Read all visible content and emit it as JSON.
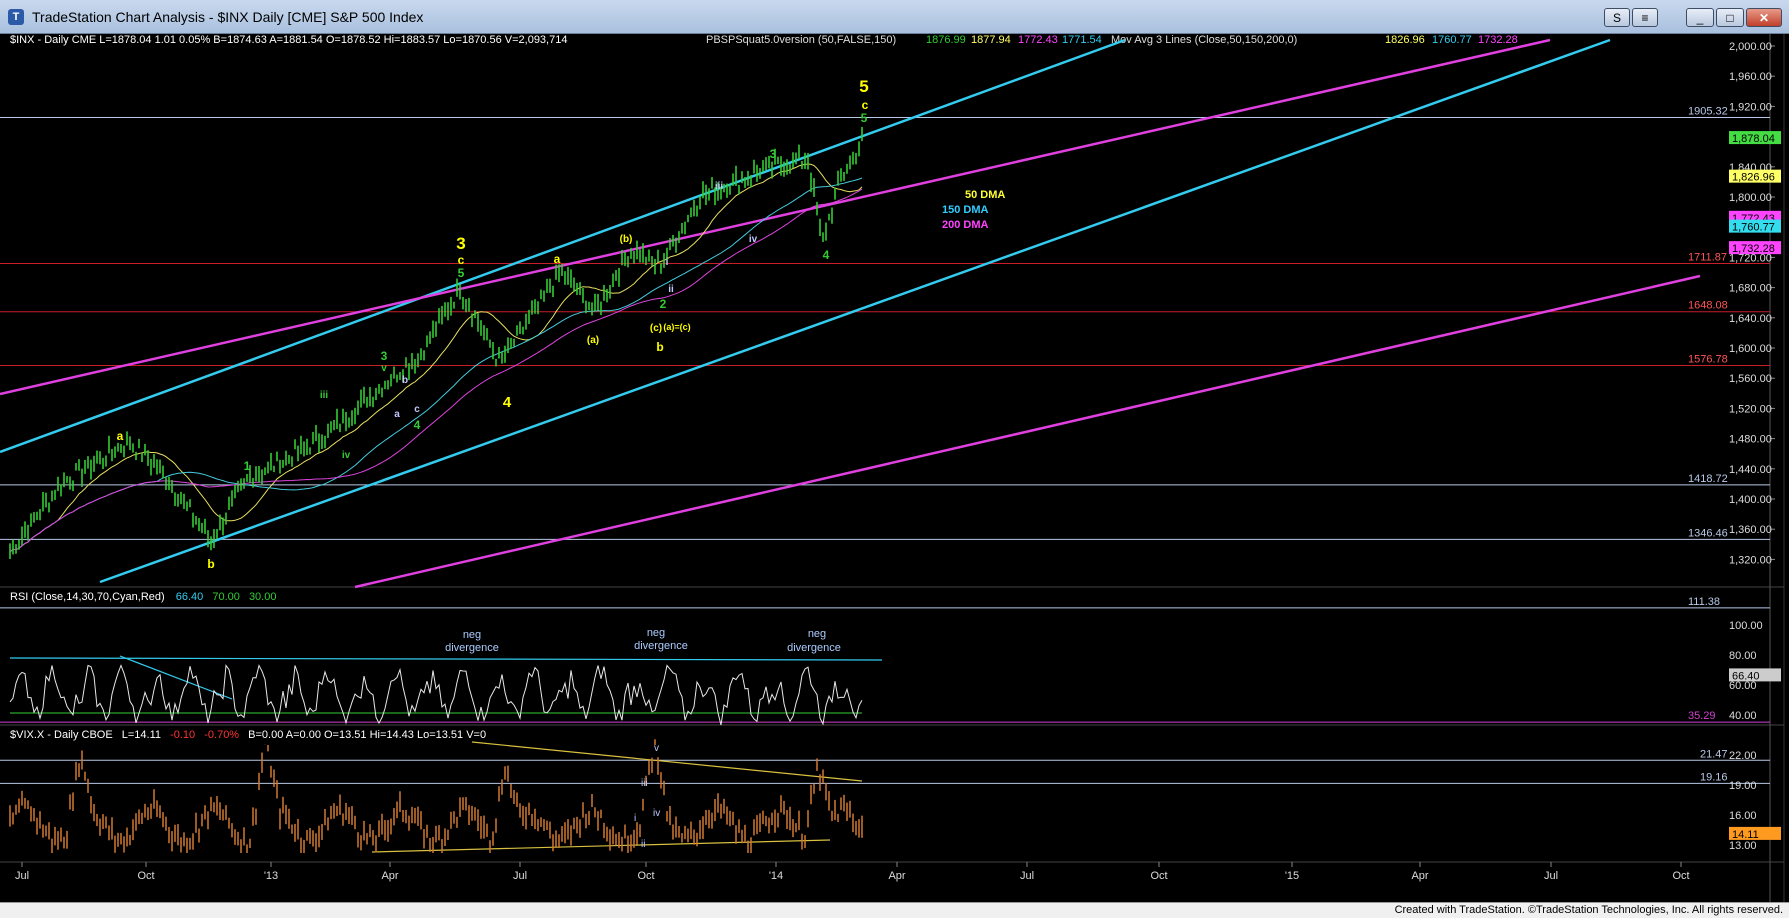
{
  "window": {
    "title": "TradeStation Chart Analysis - $INX Daily [CME] S&P 500 Index",
    "app_icon": "tradestation-icon",
    "buttons": [
      "S",
      "≡",
      "_",
      "□",
      "✕"
    ]
  },
  "price_panel": {
    "header": {
      "symbol_info": "$INX - Daily  CME  L=1878.04  1.01  0.05%  B=1874.63  A=1881.54  O=1878.52  Hi=1883.57  Lo=1870.56  V=2,093,714",
      "study": "PBSPSquat5.0version (50,FALSE,150)",
      "study_v1": "1876.99",
      "study_v2": "1877.94",
      "study_v3": "1772.43",
      "study_v4": "1771.54",
      "mov_avg": "Mov Avg 3 Lines (Close,50,150,200,0)",
      "ma_v1": "1826.96",
      "ma_v2": "1760.77",
      "ma_v3": "1732.28"
    },
    "axis_ticks": [
      "2,000.00",
      "1,960.00",
      "1,920.00",
      "1,880.00",
      "1,840.00",
      "1,800.00",
      "1,760.00",
      "1,720.00",
      "1,680.00",
      "1,640.00",
      "1,600.00",
      "1,560.00",
      "1,520.00",
      "1,480.00",
      "1,440.00",
      "1,400.00",
      "1,360.00",
      "1,320.00"
    ],
    "levels": [
      {
        "label": "1905.32",
        "value": 1905.32,
        "color": "#b8c8e6"
      },
      {
        "label": "1711.87",
        "value": 1711.87,
        "color": "#c81e2a"
      },
      {
        "label": "1648.08",
        "value": 1648.08,
        "color": "#c81e2a"
      },
      {
        "label": "1576.78",
        "value": 1576.78,
        "color": "#c81e2a"
      },
      {
        "label": "1418.72",
        "value": 1418.72,
        "color": "#b8c8e6"
      },
      {
        "label": "1346.46",
        "value": 1346.46,
        "color": "#b8c8e6"
      }
    ],
    "current_price_tag": {
      "label": "1,878.04",
      "value": 1878.04
    },
    "ma_tags": [
      {
        "label": "1,826.96",
        "value": 1826.96,
        "color": "#ffff66"
      },
      {
        "label": "1,772.43",
        "value": 1772.43,
        "color": "#ff44ff"
      },
      {
        "label": "1,760.77",
        "value": 1760.77,
        "color": "#33ddee"
      },
      {
        "label": "1,732.28",
        "value": 1732.28,
        "color": "#ff44ff"
      }
    ],
    "legend": [
      {
        "label": "50 DMA",
        "color": "#ffff33"
      },
      {
        "label": "150 DMA",
        "color": "#33ccff"
      },
      {
        "label": "200 DMA",
        "color": "#ff44ff"
      }
    ],
    "wave_labels": [
      {
        "text": "5",
        "color": "#ffff00"
      },
      {
        "text": "c",
        "color": "#ffff00"
      },
      {
        "text": "5",
        "color": "#33cc33"
      },
      {
        "text": "3",
        "color": "#ffff00"
      },
      {
        "text": "c",
        "color": "#ffff00"
      },
      {
        "text": "5",
        "color": "#33cc33"
      },
      {
        "text": "a",
        "color": "#ffff00"
      },
      {
        "text": "b",
        "color": "#ffff00"
      },
      {
        "text": "a",
        "color": "#ffff00"
      },
      {
        "text": "(b)",
        "color": "#ffff00"
      },
      {
        "text": "(a)",
        "color": "#ffff00"
      },
      {
        "text": "(c)",
        "color": "#ffff00"
      },
      {
        "text": "(a)=(c)",
        "color": "#ffff00"
      },
      {
        "text": "b",
        "color": "#ffff00"
      },
      {
        "text": "4",
        "color": "#ffff00"
      },
      {
        "text": "1",
        "color": "#33cc33"
      },
      {
        "text": "iii",
        "color": "#33cc33"
      },
      {
        "text": "iv",
        "color": "#33cc33"
      },
      {
        "text": "3",
        "color": "#33cc33"
      },
      {
        "text": "v",
        "color": "#33cc33"
      },
      {
        "text": "4",
        "color": "#33cc33"
      },
      {
        "text": "a",
        "color": "#c0c8ff"
      },
      {
        "text": "b",
        "color": "#c0c8ff"
      },
      {
        "text": "c",
        "color": "#c0c8ff"
      },
      {
        "text": "iii",
        "color": "#c0c8ff"
      },
      {
        "text": "iv",
        "color": "#c0c8ff"
      },
      {
        "text": "3",
        "color": "#33cc33"
      },
      {
        "text": "4",
        "color": "#33cc33"
      },
      {
        "text": "i",
        "color": "#c0c8ff"
      },
      {
        "text": "2",
        "color": "#33cc33"
      },
      {
        "text": "ii",
        "color": "#c0c8ff"
      }
    ]
  },
  "rsi_panel": {
    "header": "RSI (Close,14,30,70,Cyan,Red)",
    "value": "66.40",
    "ob": "70.00",
    "os": "30.00",
    "axis_ticks": [
      "100.00",
      "80.00",
      "60.00",
      "40.00"
    ],
    "levels": [
      {
        "label": "111.38",
        "value": 111.38
      },
      {
        "label": "35.29",
        "value": 35.29
      }
    ],
    "value_tag": {
      "label": "66.40",
      "value": 66.4
    },
    "annotations": [
      {
        "line1": "neg",
        "line2": "divergence"
      },
      {
        "line1": "neg",
        "line2": "divergence"
      },
      {
        "line1": "neg",
        "line2": "divergence"
      }
    ]
  },
  "vix_panel": {
    "header": {
      "symbol": "$VIX.X - Daily  CBOE",
      "last": "L=14.11",
      "change": "-0.10",
      "pct": "-0.70%",
      "rest": "B=0.00  A=0.00  O=13.51  Hi=14.43  Lo=13.51  V=0"
    },
    "axis_ticks": [
      "22.00",
      "19.00",
      "16.00",
      "13.00"
    ],
    "levels": [
      {
        "label": "21.47",
        "value": 21.47
      },
      {
        "label": "19.16",
        "value": 19.16
      }
    ],
    "value_tag": {
      "label": "14.11",
      "value": 14.11
    },
    "wave_labels": [
      "v",
      "iii",
      "iv",
      "i",
      "ii"
    ]
  },
  "x_axis": [
    "Jul",
    "Oct",
    "'13",
    "Apr",
    "Jul",
    "Oct",
    "'14",
    "Apr",
    "Jul",
    "Oct",
    "'15",
    "Apr",
    "Jul",
    "Oct"
  ],
  "footer": {
    "credit": "Created with TradeStation. ©TradeStation Technologies, Inc. All rights reserved."
  },
  "colors": {
    "price_bars": "#33cc33",
    "vix_bars": "#d07830",
    "channel_cyan": "#33ccee",
    "channel_magenta": "#e040e0"
  }
}
